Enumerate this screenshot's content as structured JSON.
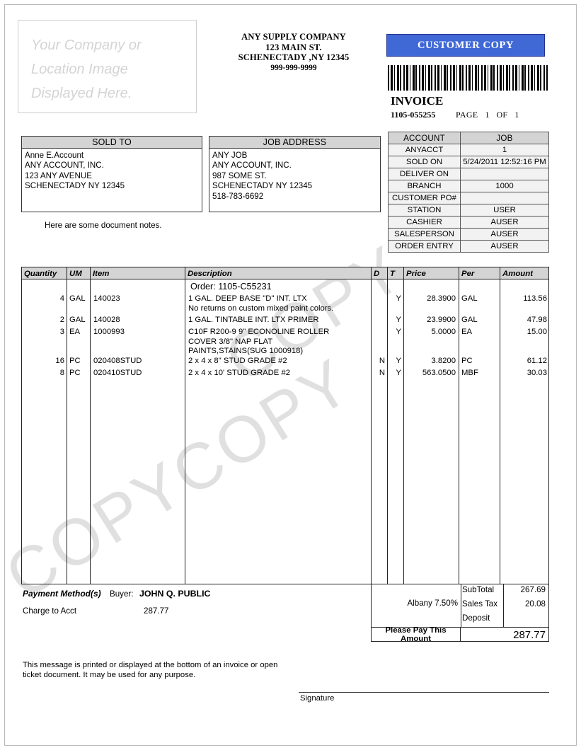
{
  "header": {
    "logo_placeholder": "Your Company or Location Image Displayed Here.",
    "company_name": "ANY SUPPLY COMPANY",
    "company_street": "123 MAIN ST.",
    "company_city": "SCHENECTADY ,NY  12345",
    "company_phone": "999-999-9999",
    "copy_banner": "CUSTOMER COPY",
    "doc_title": "INVOICE",
    "invoice_number": "1105-055255",
    "page_label": "PAGE",
    "page_current": "1",
    "page_of": "OF",
    "page_total": "1",
    "barcode_alt": "barcode"
  },
  "sold_to": {
    "title": "SOLD TO",
    "lines": "Anne E.Account\nANY ACCOUNT, INC.\n123 ANY AVENUE\nSCHENECTADY  NY  12345"
  },
  "job_address": {
    "title": "JOB ADDRESS",
    "lines": "ANY JOB\nANY ACCOUNT, INC.\n987 SOME ST.\nSCHENECTADY  NY  12345\n518-783-6692"
  },
  "document_notes": "Here are some document notes.",
  "account_table": {
    "headers": [
      "ACCOUNT",
      "JOB"
    ],
    "rows": [
      {
        "label": "ANYACCT",
        "value": "1"
      },
      {
        "label": "SOLD ON",
        "value": "5/24/2011 12:52:16 PM"
      },
      {
        "label": "DELIVER ON",
        "value": ""
      },
      {
        "label": "BRANCH",
        "value": "1000"
      },
      {
        "label": "CUSTOMER PO#",
        "value": ""
      },
      {
        "label": "STATION",
        "value": "USER"
      },
      {
        "label": "CASHIER",
        "value": "AUSER"
      },
      {
        "label": "SALESPERSON",
        "value": "AUSER"
      },
      {
        "label": "ORDER ENTRY",
        "value": "AUSER"
      }
    ]
  },
  "items": {
    "headers": [
      "Quantity",
      "UM",
      "Item",
      "Description",
      "D",
      "T",
      "Price",
      "Per",
      "Amount"
    ],
    "order_line": "Order:    1105-C55231",
    "rows": [
      {
        "quantity": "4",
        "um": "GAL",
        "item": "140023",
        "description": "1 GAL. DEEP BASE \"D\" INT. LTX\nNo returns on custom mixed paint colors.",
        "d": "",
        "t": "Y",
        "price": "28.3900",
        "per": "GAL",
        "amount": "113.56"
      },
      {
        "quantity": "2",
        "um": "GAL",
        "item": "140028",
        "description": "1 GAL. TINTABLE INT. LTX PRIMER",
        "d": "",
        "t": "Y",
        "price": "23.9900",
        "per": "GAL",
        "amount": "47.98"
      },
      {
        "quantity": "3",
        "um": "EA",
        "item": "1000993",
        "description": "C10F R200-9  9\" ECONOLINE ROLLER\nCOVER 3/8\" NAP  FLAT\nPAINTS,STAINS(SUG 1000918)",
        "d": "",
        "t": "Y",
        "price": "5.0000",
        "per": "EA",
        "amount": "15.00"
      },
      {
        "quantity": "16",
        "um": "PC",
        "item": "020408STUD",
        "description": "2 x 4 x 8\" STUD GRADE #2",
        "d": "N",
        "t": "Y",
        "price": "3.8200",
        "per": "PC",
        "amount": "61.12"
      },
      {
        "quantity": "8",
        "um": "PC",
        "item": "020410STUD",
        "description": "2 x 4 x 10' STUD GRADE #2",
        "d": "N",
        "t": "Y",
        "price": "563.0500",
        "per": "MBF",
        "amount": "30.03"
      }
    ]
  },
  "totals": {
    "tax_jurisdiction": "Albany 7.50%",
    "subtotal_label": "SubTotal",
    "subtotal_value": "267.69",
    "sales_tax_label": "Sales Tax",
    "sales_tax_value": "20.08",
    "deposit_label": "Deposit",
    "deposit_value": "",
    "pay_this_label": "Please Pay This Amount",
    "pay_this_value": "287.77"
  },
  "payment": {
    "title": "Payment Method(s)",
    "buyer_label": "Buyer:",
    "buyer_name": "JOHN Q. PUBLIC",
    "method": "Charge to Acct",
    "amount": "287.77"
  },
  "footer": {
    "message": "This message is printed or displayed at the bottom of an invoice or open ticket document.  It may be used for any purpose.",
    "signature_label": "Signature"
  },
  "watermark": {
    "text": "COPY"
  },
  "colors": {
    "banner_blue": "#4169d6",
    "header_gray": "#d4d4d4",
    "watermark_gray": "#e0e0e0"
  }
}
